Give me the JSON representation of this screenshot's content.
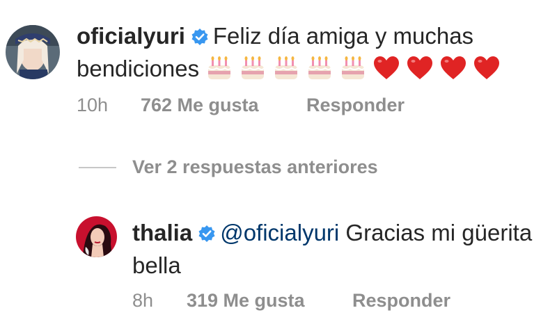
{
  "comment_1": {
    "username": "oficialyuri",
    "text": "Feliz día amiga y muchas bendiciones",
    "emojis": [
      "birthday-cake-emoji",
      "birthday-cake-emoji",
      "birthday-cake-emoji",
      "birthday-cake-emoji",
      "birthday-cake-emoji",
      "red-heart-emoji",
      "red-heart-emoji",
      "red-heart-emoji",
      "red-heart-emoji"
    ],
    "time": "10h",
    "likes": "762 Me gusta",
    "reply_label": "Responder"
  },
  "replies_toggle": "Ver 2 respuestas anteriores",
  "comment_2": {
    "username": "thalia",
    "mention": "@oficialyuri",
    "text": "Gracias mi güerita bella",
    "time": "8h",
    "likes": "319 Me gusta",
    "reply_label": "Responder"
  },
  "colors": {
    "verified_badge": "#3897f0",
    "mention": "#00376b",
    "meta_text": "#8e8e8e",
    "heart": "#e02424"
  }
}
